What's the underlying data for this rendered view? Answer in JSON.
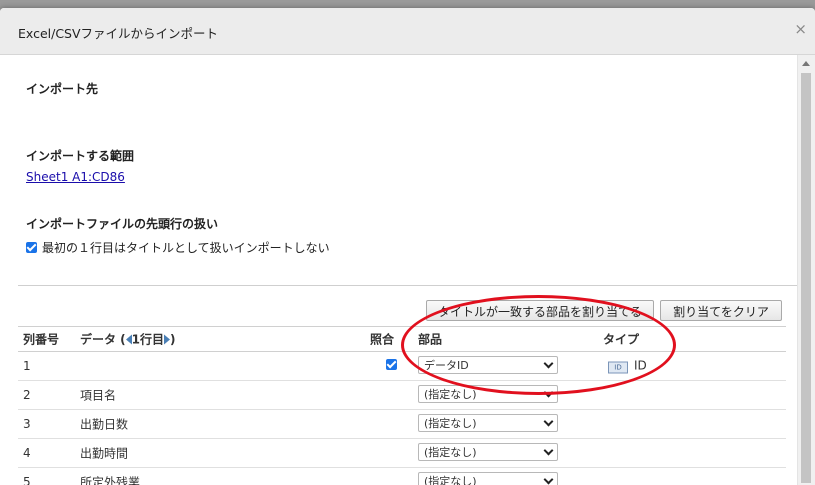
{
  "dialog": {
    "title": "Excel/CSVファイルからインポート",
    "close_glyph": "×"
  },
  "sections": {
    "dest_title": "インポート先",
    "range_title": "インポートする範囲",
    "range_link": "Sheet1 A1:CD86",
    "header_title": "インポートファイルの先頭行の扱い",
    "header_checkbox_label": "最初の１行目はタイトルとして扱いインポートしない"
  },
  "buttons": {
    "assign": "タイトルが一致する部品を割り当てる",
    "clear": "割り当てをクリア"
  },
  "table": {
    "headers": {
      "col_no": "列番号",
      "data": "データ (",
      "row_label": "1行目",
      "data_close": ")",
      "match": "照合",
      "part": "部品",
      "type": "タイプ"
    },
    "rows": [
      {
        "no": "1",
        "data": "",
        "match": true,
        "part": "データID",
        "type": "ID"
      },
      {
        "no": "2",
        "data": "項目名",
        "match": false,
        "part": "(指定なし)",
        "type": ""
      },
      {
        "no": "3",
        "data": "出勤日数",
        "match": false,
        "part": "(指定なし)",
        "type": ""
      },
      {
        "no": "4",
        "data": "出勤時間",
        "match": false,
        "part": "(指定なし)",
        "type": ""
      },
      {
        "no": "5",
        "data": "所定外残業",
        "match": false,
        "part": "(指定なし)",
        "type": ""
      }
    ]
  },
  "colors": {
    "annotation": "#e1101e",
    "link": "#1a0dab",
    "checkbox": "#1a73e8"
  }
}
